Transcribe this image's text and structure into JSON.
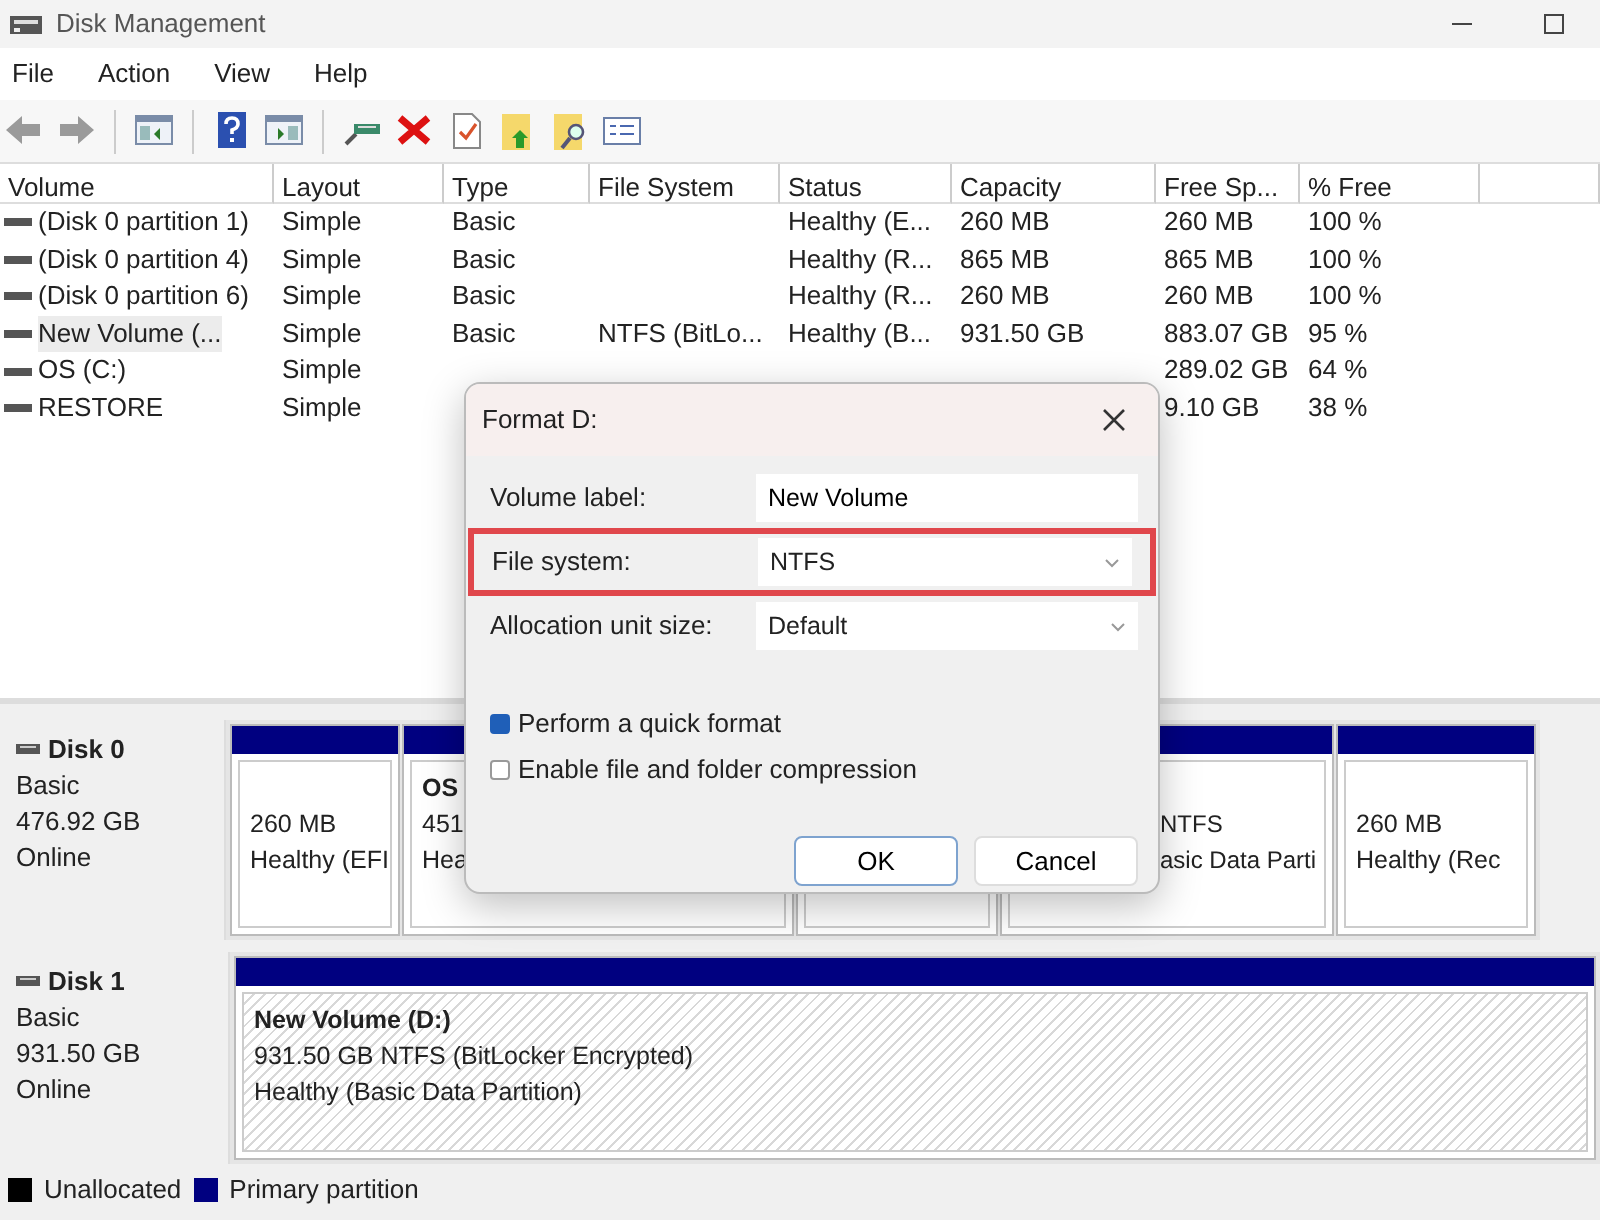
{
  "window": {
    "title": "Disk Management"
  },
  "menu": [
    "File",
    "Action",
    "View",
    "Help"
  ],
  "toolbar": [
    {
      "kind": "back"
    },
    {
      "kind": "forward"
    },
    {
      "kind": "sep"
    },
    {
      "kind": "tree"
    },
    {
      "kind": "sep"
    },
    {
      "kind": "help"
    },
    {
      "kind": "pane"
    },
    {
      "kind": "sep"
    },
    {
      "kind": "plug"
    },
    {
      "kind": "delete"
    },
    {
      "kind": "check"
    },
    {
      "kind": "folderup"
    },
    {
      "kind": "foldersearch"
    },
    {
      "kind": "list"
    }
  ],
  "volumes": {
    "columns": [
      "Volume",
      "Layout",
      "Type",
      "File System",
      "Status",
      "Capacity",
      "Free Sp...",
      "% Free"
    ],
    "rows": [
      {
        "selected": false,
        "cells": [
          "(Disk 0 partition 1)",
          "Simple",
          "Basic",
          "",
          "Healthy (E...",
          "260 MB",
          "260 MB",
          "100 %"
        ]
      },
      {
        "selected": false,
        "cells": [
          "(Disk 0 partition 4)",
          "Simple",
          "Basic",
          "",
          "Healthy (R...",
          "865 MB",
          "865 MB",
          "100 %"
        ]
      },
      {
        "selected": false,
        "cells": [
          "(Disk 0 partition 6)",
          "Simple",
          "Basic",
          "",
          "Healthy (R...",
          "260 MB",
          "260 MB",
          "100 %"
        ]
      },
      {
        "selected": true,
        "cells": [
          "New Volume (...",
          "Simple",
          "Basic",
          "NTFS (BitLo...",
          "Healthy (B...",
          "931.50 GB",
          "883.07 GB",
          "95 %"
        ]
      },
      {
        "selected": false,
        "cells": [
          "OS (C:)",
          "Simple",
          "",
          "",
          "",
          "",
          "289.02 GB",
          "64 %"
        ]
      },
      {
        "selected": false,
        "cells": [
          "RESTORE",
          "Simple",
          "",
          "",
          "",
          "",
          "9.10 GB",
          "38 %"
        ]
      }
    ]
  },
  "disks": [
    {
      "name": "Disk 0",
      "lines": [
        "Basic",
        "476.92 GB",
        "Online"
      ],
      "partitions": [
        {
          "selected": false,
          "lines": [
            "260 MB",
            "Healthy (EFI"
          ]
        },
        {
          "selected": false,
          "label": "OS",
          "lines": [
            "451",
            "Hea"
          ]
        },
        {
          "selected": false
        },
        {
          "selected": false,
          "lines": [
            "NTFS",
            "asic Data Parti"
          ]
        },
        {
          "selected": false,
          "lines": [
            "260 MB",
            "Healthy (Rec"
          ]
        }
      ]
    },
    {
      "name": "Disk 1",
      "lines": [
        "Basic",
        "931.50 GB",
        "Online"
      ],
      "partitions": [
        {
          "selected": true,
          "label": "New Volume  (D:)",
          "lines": [
            "931.50 GB NTFS (BitLocker Encrypted)",
            "Healthy (Basic Data Partition)"
          ]
        }
      ]
    }
  ],
  "legend": [
    {
      "label": "Unallocated",
      "color": "#000000"
    },
    {
      "label": "Primary partition",
      "color": "#000080"
    }
  ],
  "dialog": {
    "title": "Format D:",
    "fields": [
      {
        "kind": "text",
        "label": "Volume label:",
        "value": "New Volume",
        "highlighted": false
      },
      {
        "kind": "select",
        "label": "File system:",
        "value": "NTFS",
        "highlighted": true
      },
      {
        "kind": "select",
        "label": "Allocation unit size:",
        "value": "Default",
        "highlighted": false
      }
    ],
    "options": [
      {
        "label": "Perform a quick format",
        "checked": true
      },
      {
        "label": "Enable file and folder compression",
        "checked": false
      }
    ],
    "buttons": [
      {
        "label": "OK",
        "default": true
      },
      {
        "label": "Cancel",
        "default": false
      }
    ]
  }
}
